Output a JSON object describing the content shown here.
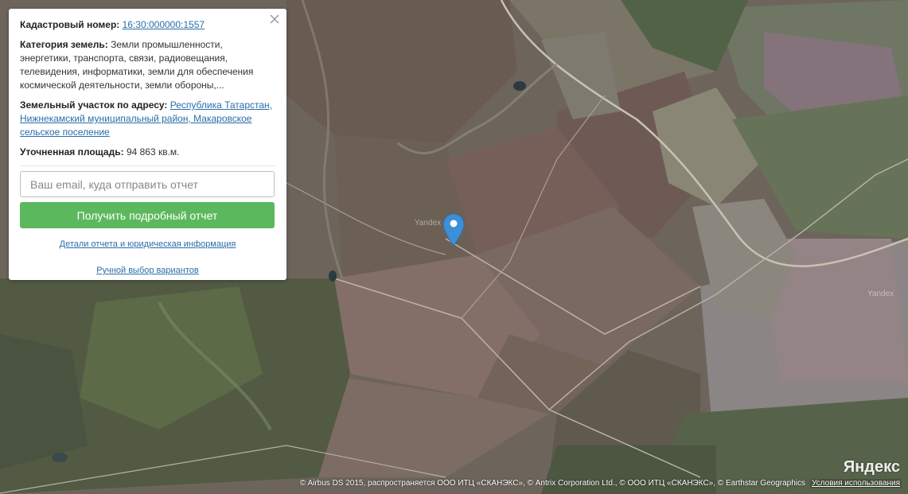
{
  "card": {
    "cadastral_label": "Кадастровый номер:",
    "cadastral_value": "16:30:000000:1557",
    "category_label": "Категория земель:",
    "category_value": "Земли промышленности, энергетики, транспорта, связи, радиовещания, телевидения, информатики, земли для обеспечения космической деятельности, земли обороны,...",
    "address_label": "Земельный участок по адресу:",
    "address_value": "Республика Татарстан, Нижнекамский муниципальный район, Макаровское сельское поселение",
    "area_label": "Уточненная площадь:",
    "area_value": "94 863 кв.м.",
    "email_placeholder": "Ваш email, куда отправить отчет",
    "report_button": "Получить подробный отчет",
    "details_link": "Детали отчета и юридическая информация",
    "manual_link": "Ручной выбор вариантов"
  },
  "map": {
    "tile_label_1": "Yandex",
    "tile_label_2": "Yandex",
    "logo": "Яндекс",
    "attribution": "© Airbus DS 2015, распространяется ООО ИТЦ «СКАНЭКС», © Antrix Corporation Ltd., © ООО ИТЦ «СКАНЭКС», © Earthstar Geographics",
    "terms": "Условия использования",
    "pin_color": "#3d8fd6"
  },
  "colors": {
    "button_green": "#5cb85c",
    "link_blue": "#2a6ea8"
  }
}
